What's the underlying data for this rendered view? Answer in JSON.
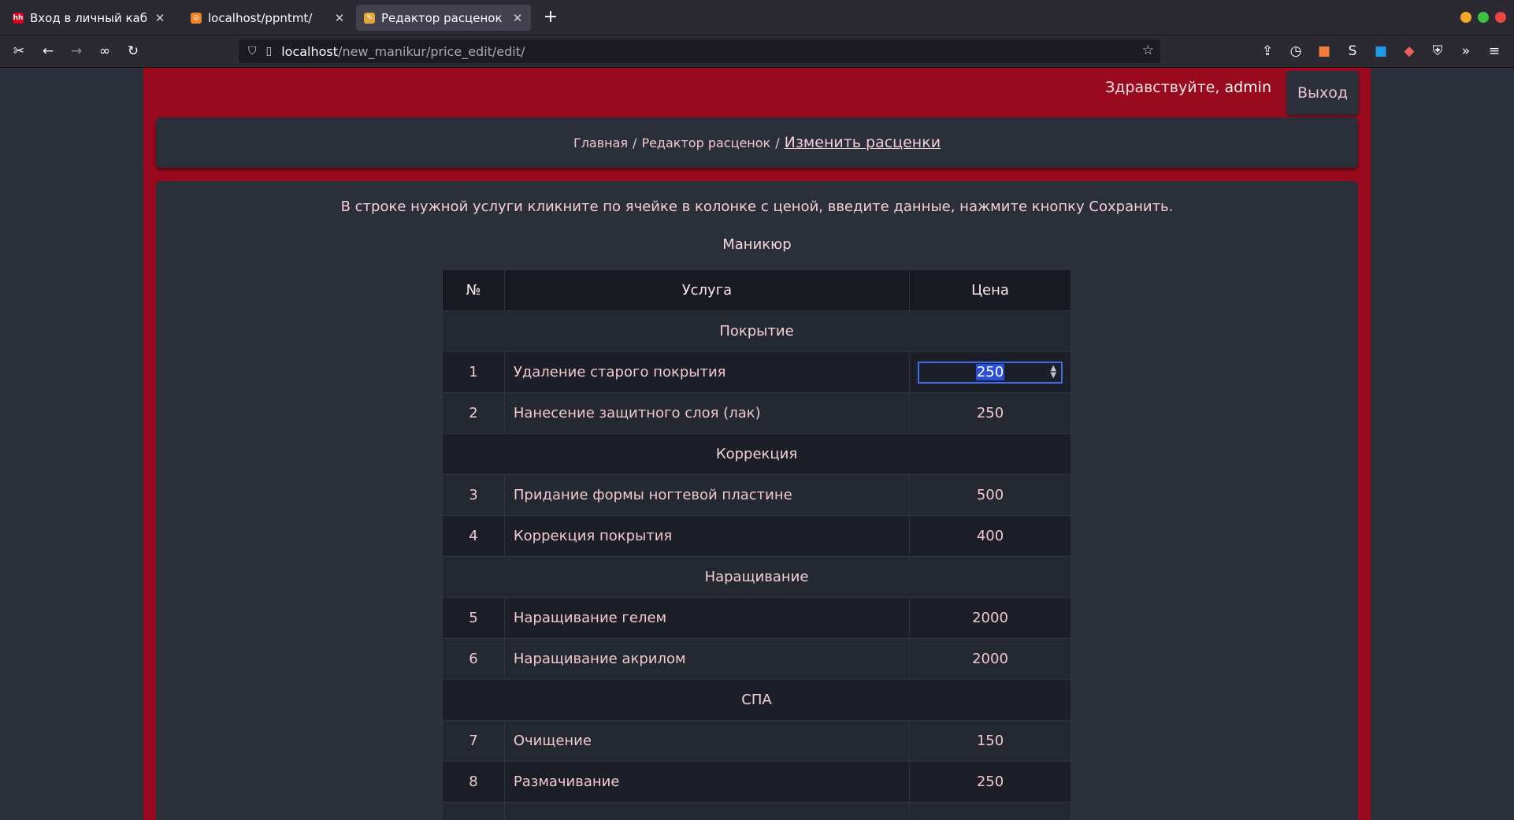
{
  "browser": {
    "tabs": [
      {
        "title": "Вход в личный кабинет",
        "favicon": "hh"
      },
      {
        "title": "localhost/ppntmt/",
        "favicon": "pma"
      },
      {
        "title": "Редактор расценок",
        "favicon": "pencil"
      }
    ],
    "url_host": "localhost",
    "url_path": "/new_manikur/price_edit/edit/"
  },
  "header": {
    "greeting": "Здравствуйте,",
    "user": "admin",
    "logout_label": "Выход"
  },
  "breadcrumb": {
    "home": "Главная",
    "editor": "Редактор расценок",
    "current": "Изменить расценки"
  },
  "intro_text": "В строке нужной услуги кликните по ячейке в колонке с ценой, введите данные, нажмите кнопку Сохранить.",
  "section_title": "Маникюр",
  "table": {
    "headers": [
      "№",
      "Услуга",
      "Цена"
    ],
    "groups": [
      "Покрытие",
      "Коррекция",
      "Наращивание",
      "СПА"
    ],
    "rows": [
      {
        "num": "1",
        "service": "Удаление старого покрытия",
        "price": "250"
      },
      {
        "num": "2",
        "service": "Нанесение защитного слоя (лак)",
        "price": "250"
      },
      {
        "num": "3",
        "service": "Придание формы ногтевой пластине",
        "price": "500"
      },
      {
        "num": "4",
        "service": "Коррекция покрытия",
        "price": "400"
      },
      {
        "num": "5",
        "service": "Наращивание гелем",
        "price": "2000"
      },
      {
        "num": "6",
        "service": "Наращивание акрилом",
        "price": "2000"
      },
      {
        "num": "7",
        "service": "Очищение",
        "price": "150"
      },
      {
        "num": "8",
        "service": "Размачивание",
        "price": "250"
      }
    ]
  },
  "colors": {
    "accent": "#9a0a1e",
    "panel": "#2a2f3a",
    "focus": "#3c6df0"
  }
}
